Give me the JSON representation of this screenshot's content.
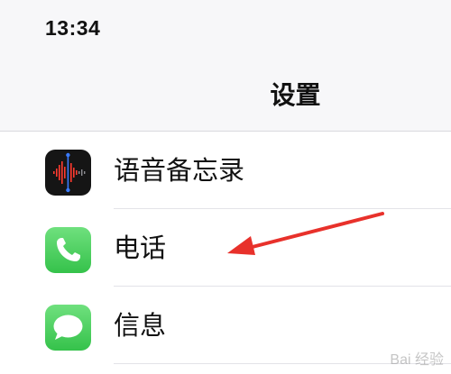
{
  "status_bar": {
    "time": "13:34"
  },
  "nav": {
    "title": "设置"
  },
  "settings_rows": [
    {
      "label": "语音备忘录",
      "icon": "voice-memos-icon"
    },
    {
      "label": "电话",
      "icon": "phone-icon"
    },
    {
      "label": "信息",
      "icon": "messages-icon"
    }
  ],
  "annotation": {
    "type": "arrow",
    "color": "#e8312b",
    "points_to": "电话"
  },
  "watermark": {
    "text": "Bai 经验"
  },
  "colors": {
    "green_icon": "#35c24b",
    "arrow": "#e8312b",
    "voice_icon_bg": "#151515"
  }
}
